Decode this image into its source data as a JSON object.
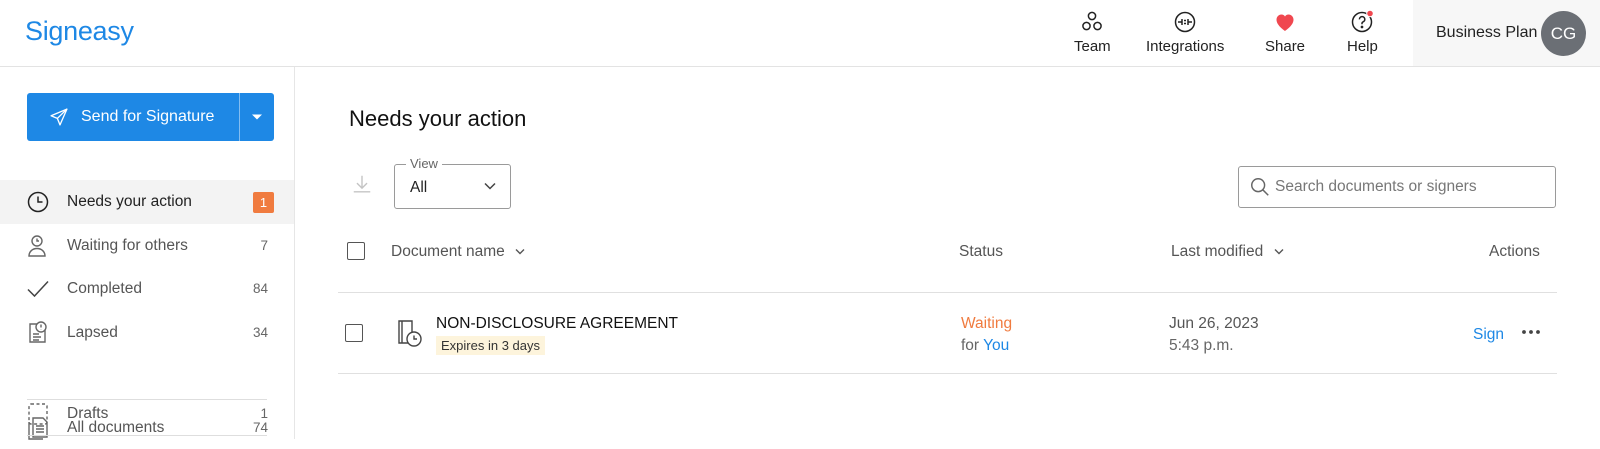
{
  "app": {
    "logo": "Signeasy"
  },
  "topnav": {
    "items": [
      {
        "label": "Team",
        "icon": "team-icon"
      },
      {
        "label": "Integrations",
        "icon": "integrations-icon"
      },
      {
        "label": "Share",
        "icon": "heart-icon"
      },
      {
        "label": "Help",
        "icon": "help-icon"
      }
    ],
    "plan": "Business Plan",
    "avatar_initials": "CG"
  },
  "sidebar": {
    "send_button": "Send for Signature",
    "items": [
      {
        "label": "Needs your action",
        "badge": "1",
        "icon": "clock-icon"
      },
      {
        "label": "Waiting for others",
        "count": "7",
        "icon": "person-clock-icon"
      },
      {
        "label": "Completed",
        "count": "84",
        "icon": "checkmark-icon"
      },
      {
        "label": "Lapsed",
        "count": "34",
        "icon": "lapsed-document-icon"
      },
      {
        "label": "All documents",
        "count": "74",
        "icon": "documents-icon"
      },
      {
        "label": "Drafts",
        "count": "1",
        "icon": "draft-icon"
      }
    ]
  },
  "main": {
    "title": "Needs your action",
    "view": {
      "legend": "View",
      "value": "All"
    },
    "search": {
      "placeholder": "Search documents or signers"
    },
    "table": {
      "headers": {
        "document_name": "Document name",
        "status": "Status",
        "last_modified": "Last modified",
        "actions": "Actions"
      },
      "rows": [
        {
          "name": "NON-DISCLOSURE AGREEMENT",
          "expires": "Expires in 3 days",
          "status": "Waiting",
          "status_for": "for",
          "status_who": "You",
          "date": "Jun 26, 2023",
          "time": "5:43 p.m.",
          "action": "Sign"
        }
      ]
    }
  },
  "colors": {
    "brand": "#1e88e5",
    "badge": "#f07b3f",
    "waiting": "#f07b3f",
    "heart": "#f0474f"
  }
}
